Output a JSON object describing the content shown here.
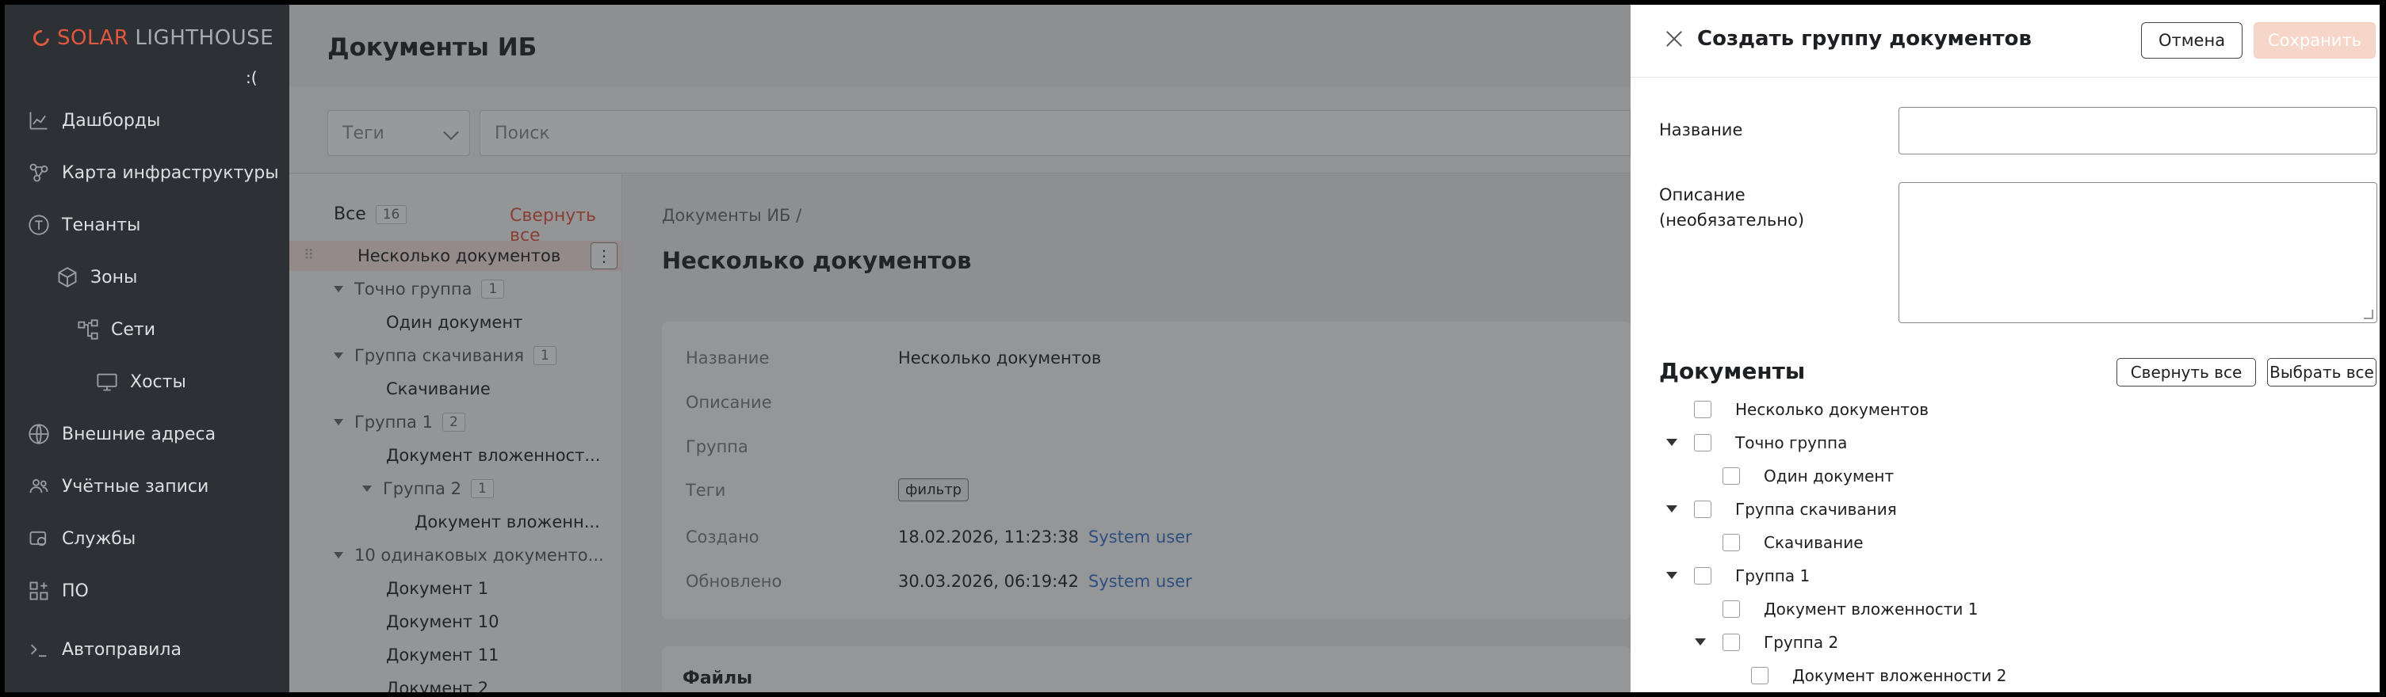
{
  "sidebar": {
    "logo_brand": "SOLAR",
    "logo_rest": "LIGHTHOUSE",
    "status_glyph": ":(",
    "items": [
      {
        "label": "Дашборды",
        "icon": "chart-line-icon"
      },
      {
        "label": "Карта инфраструктуры",
        "icon": "network-map-icon"
      },
      {
        "label": "Тенанты",
        "icon": "tenant-icon"
      },
      {
        "label": "Зоны",
        "icon": "cube-icon"
      },
      {
        "label": "Сети",
        "icon": "network-icon"
      },
      {
        "label": "Хосты",
        "icon": "monitor-icon"
      },
      {
        "label": "Внешние адреса",
        "icon": "globe-icon"
      },
      {
        "label": "Учётные записи",
        "icon": "users-icon"
      },
      {
        "label": "Службы",
        "icon": "services-icon"
      },
      {
        "label": "ПО",
        "icon": "apps-icon"
      },
      {
        "label": "Автоправила",
        "icon": "terminal-icon"
      }
    ]
  },
  "main": {
    "title": "Документы ИБ",
    "filters": {
      "tags_placeholder": "Теги",
      "search_placeholder": "Поиск"
    },
    "tree": {
      "all_label": "Все",
      "all_count": "16",
      "collapse_label": "Свернуть все",
      "rows": [
        {
          "label": "Несколько документов"
        },
        {
          "label": "Точно группа",
          "count": "1"
        },
        {
          "label": "Один документ"
        },
        {
          "label": "Группа скачивания",
          "count": "1"
        },
        {
          "label": "Скачивание"
        },
        {
          "label": "Группа 1",
          "count": "2"
        },
        {
          "label": "Документ вложенност..."
        },
        {
          "label": "Группа 2",
          "count": "1"
        },
        {
          "label": "Документ вложенн..."
        },
        {
          "label": "10 одинаковых документо..."
        },
        {
          "label": "Документ 1"
        },
        {
          "label": "Документ 10"
        },
        {
          "label": "Документ 11"
        },
        {
          "label": "Документ 2"
        }
      ]
    },
    "detail": {
      "breadcrumb": "Документы ИБ /",
      "title": "Несколько документов",
      "fields": {
        "name_label": "Название",
        "name_value": "Несколько документов",
        "desc_label": "Описание",
        "group_label": "Группа",
        "tags_label": "Теги",
        "tag_value": "фильтр",
        "created_label": "Создано",
        "created_value": "18.02.2026, 11:23:38",
        "created_user": "System user",
        "updated_label": "Обновлено",
        "updated_value": "30.03.2026, 06:19:42",
        "updated_user": "System user"
      },
      "files_title": "Файлы"
    }
  },
  "drawer": {
    "title": "Создать группу документов",
    "cancel_label": "Отмена",
    "save_label": "Сохранить",
    "name_label": "Название",
    "desc_label_1": "Описание",
    "desc_label_2": "(необязательно)",
    "name_value": "",
    "desc_value": "",
    "docs_title": "Документы",
    "collapse_all": "Свернуть все",
    "select_all": "Выбрать все",
    "docs": [
      {
        "label": "Несколько документов"
      },
      {
        "label": "Точно группа"
      },
      {
        "label": "Один документ"
      },
      {
        "label": "Группа скачивания"
      },
      {
        "label": "Скачивание"
      },
      {
        "label": "Группа 1"
      },
      {
        "label": "Документ вложенности 1"
      },
      {
        "label": "Группа 2"
      },
      {
        "label": "Документ вложенности 2"
      }
    ]
  },
  "colors": {
    "accent": "#e25436",
    "link": "#3473c9",
    "sidebar_bg": "#2d3034"
  }
}
